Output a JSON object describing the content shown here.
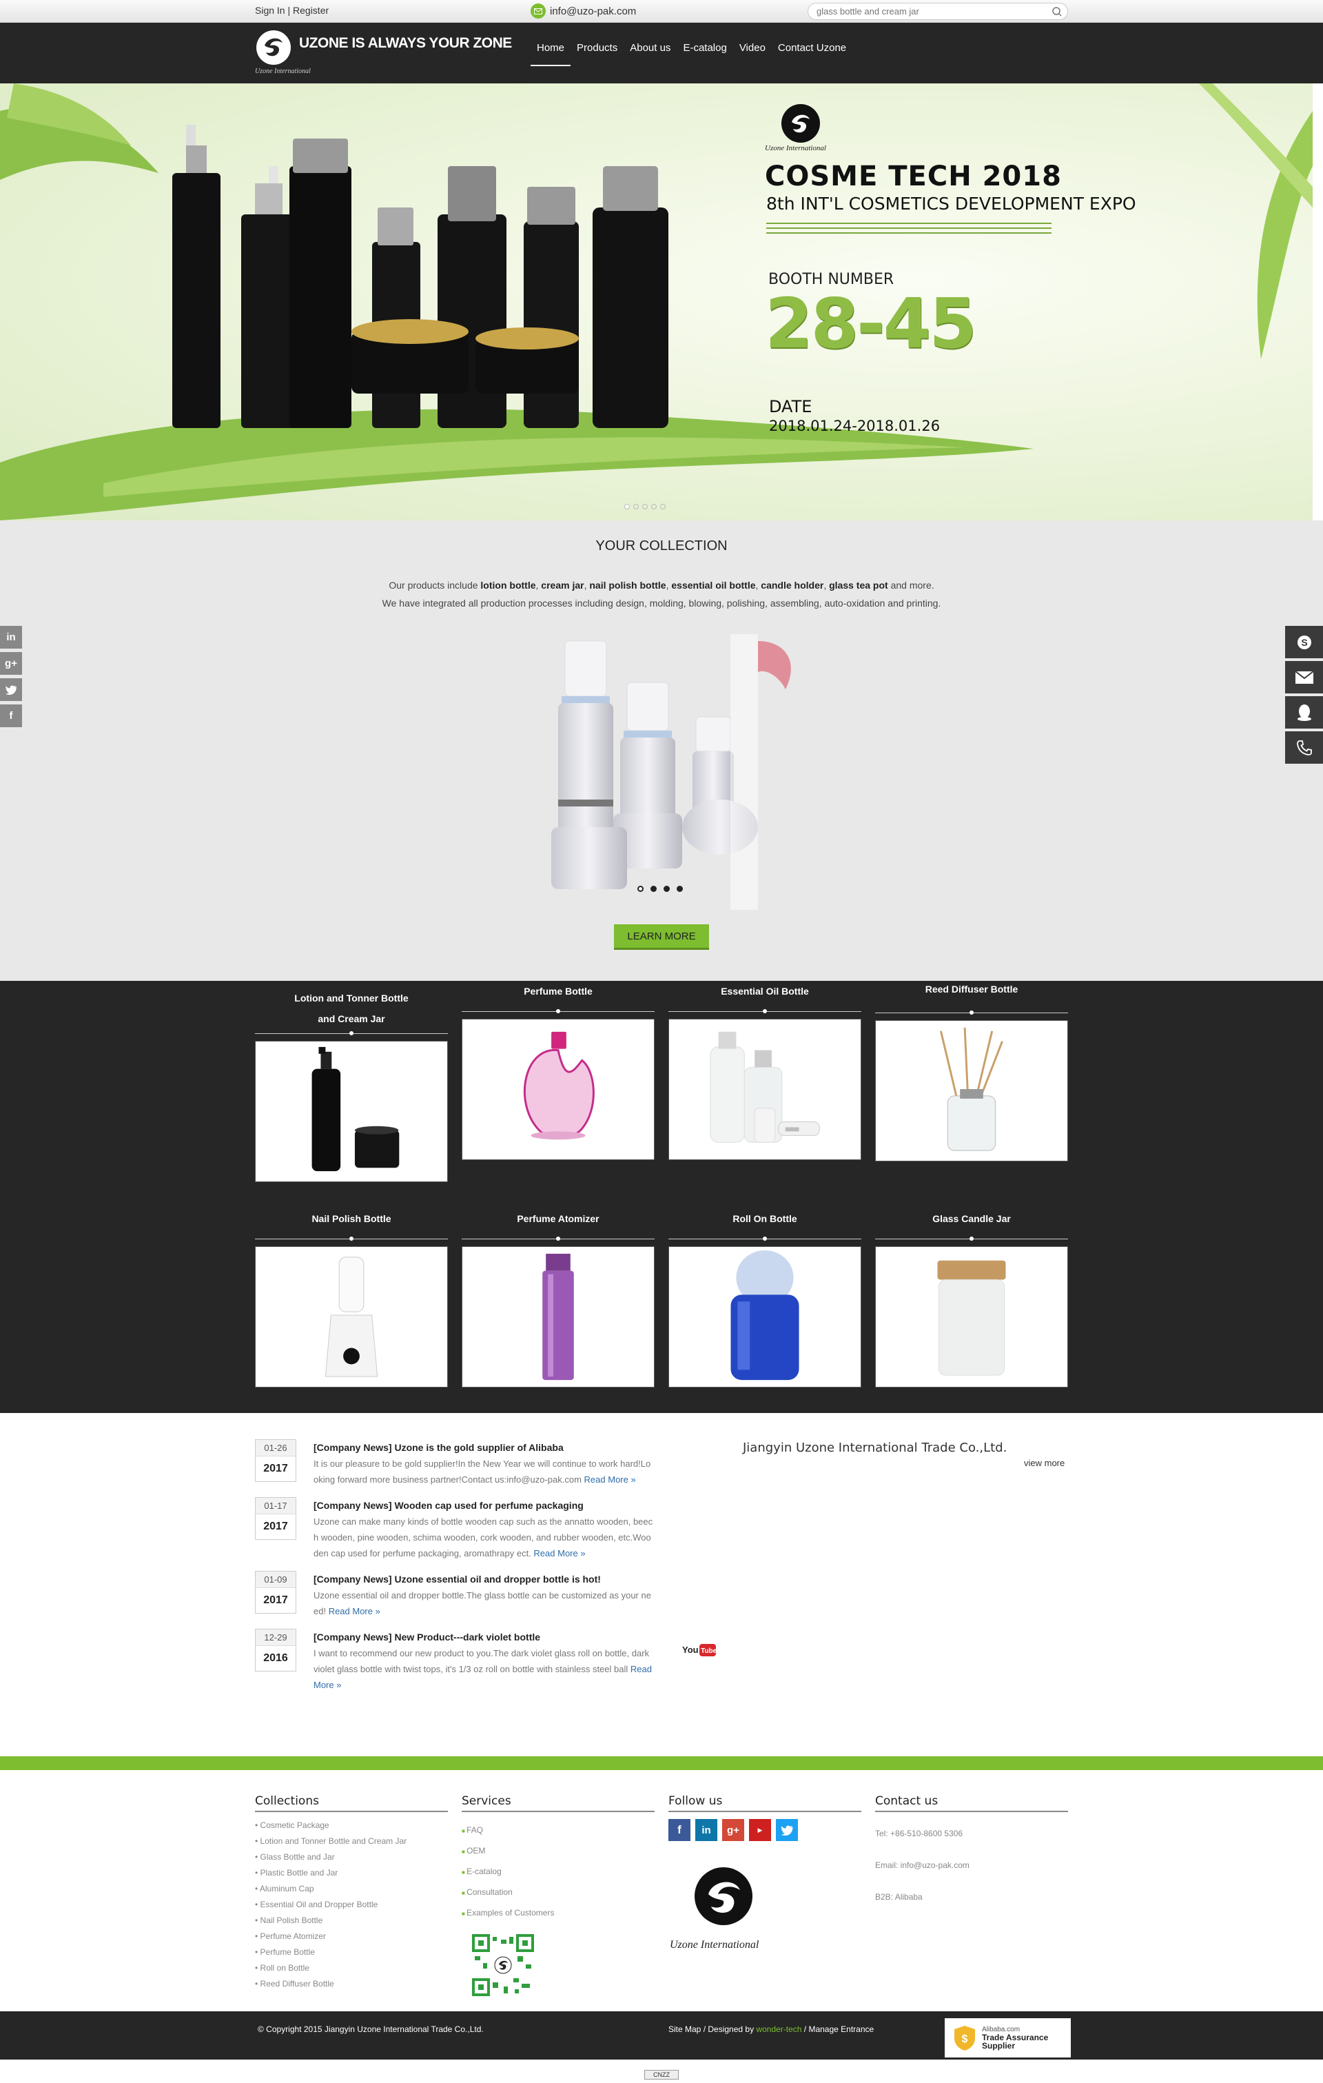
{
  "topbar": {
    "sign_in": "Sign In",
    "separator": "|",
    "register": "Register",
    "email": "info@uzo-pak.com",
    "search_placeholder": "glass bottle and cream jar",
    "search_icon": "search-icon"
  },
  "header": {
    "logo_text": "UZONE IS ALWAYS YOUR ZONE",
    "logo_sub": "Uzone International",
    "nav": [
      {
        "label": "Home",
        "active": true
      },
      {
        "label": "Products"
      },
      {
        "label": "About us"
      },
      {
        "label": "E-catalog"
      },
      {
        "label": "Video"
      },
      {
        "label": "Contact Uzone"
      }
    ]
  },
  "banner": {
    "logo_sub": "Uzone International",
    "title": "COSME TECH 2018",
    "subtitle": "8th INT'L COSMETICS DEVELOPMENT EXPO",
    "booth_label": "BOOTH NUMBER",
    "booth_number": "28-45",
    "date_label": "DATE",
    "date_value": "2018.01.24-2018.01.26",
    "slide_count": 5,
    "active_slide": 1
  },
  "collection": {
    "title": "YOUR COLLECTION",
    "desc_prefix": "Our products include ",
    "desc_items": [
      "lotion bottle",
      "cream jar",
      "nail polish bottle",
      "essential oil bottle",
      "candle holder",
      "glass tea pot"
    ],
    "desc_suffix": " and more.",
    "desc_line2": "We have integrated all production processes including design,  molding, blowing, polishing, assembling, auto-oxidation and printing.",
    "button": "LEARN MORE"
  },
  "products": [
    {
      "name": "Lotion and Tonner Bottle and Cream Jar"
    },
    {
      "name": "Perfume Bottle"
    },
    {
      "name": "Essential Oil Bottle"
    },
    {
      "name": "Reed Diffuser Bottle"
    },
    {
      "name": "Nail Polish Bottle"
    },
    {
      "name": "Perfume Atomizer"
    },
    {
      "name": "Roll On Bottle"
    },
    {
      "name": "Glass Candle Jar"
    }
  ],
  "news": [
    {
      "md": "01-26",
      "yr": "2017",
      "title": "[Company News] Uzone is the gold supplier of Alibaba",
      "text": "It is our pleasure to be gold supplier!In the New Year we will continue to work hard!Looking forward more business partner!Contact us:info@uzo-pak.com ",
      "more": "Read More »"
    },
    {
      "md": "01-17",
      "yr": "2017",
      "title": "[Company News] Wooden cap used for perfume packaging",
      "text": "Uzone can make many kinds of bottle wooden cap such as the annatto wooden, beech wooden, pine wooden, schima wooden, cork wooden, and rubber wooden, etc.Wooden cap used for perfume packaging, aromathrapy ect. ",
      "more": "Read More »"
    },
    {
      "md": "01-09",
      "yr": "2017",
      "title": "[Company News] Uzone essential oil and dropper bottle is hot!",
      "text": "Uzone essential oil and dropper bottle.The glass bottle can be customized as your need! ",
      "more": "Read More »"
    },
    {
      "md": "12-29",
      "yr": "2016",
      "title": "[Company News] New Product---dark violet bottle",
      "text": "I want to recommend our new product to you.The dark violet glass roll on bottle, dark violet glass bottle with twist tops, it's 1/3 oz roll on bottle with stainless steel ball ",
      "more": "Read More »"
    }
  ],
  "company": {
    "name": "Jiangyin Uzone International Trade Co.,Ltd.",
    "view_more": "view more",
    "youtube": "YouTube"
  },
  "footer": {
    "collections_title": "Collections",
    "collections": [
      "Cosmetic Package",
      "Lotion and Tonner Bottle and Cream Jar",
      "Glass Bottle and Jar",
      "Plastic Bottle and Jar",
      "Aluminum Cap",
      "Essential Oil and Dropper Bottle",
      "Nail Polish Bottle",
      "Perfume Atomizer",
      "Perfume Bottle",
      "Roll on Bottle",
      "Reed Diffuser Bottle"
    ],
    "services_title": "Services",
    "services": [
      "FAQ",
      "OEM",
      "E-catalog",
      "Consultation",
      "Examples of Customers"
    ],
    "follow_title": "Follow us",
    "follow_logo_sub": "Uzone International",
    "contact_title": "Contact us",
    "tel": "Tel: +86-510-8600 5306",
    "email": "Email: info@uzo-pak.com",
    "b2b": "B2B: Alibaba"
  },
  "bottom": {
    "copyright": "© Copyright  2015  Jiangyin Uzone International Trade Co.,Ltd.",
    "sitemap": "Site Map",
    "designed_by": " / Designed by ",
    "designer": "wonder-tech",
    "manage": " / Manage Entrance",
    "alibaba_site": "Alibaba.com",
    "trade_assurance": "Trade Assurance",
    "supplier": "Supplier",
    "cnzz": "CNZZ"
  },
  "colors": {
    "accent_green": "#7dbd2f",
    "dark": "#262626",
    "link_blue": "#2f6ea8"
  }
}
